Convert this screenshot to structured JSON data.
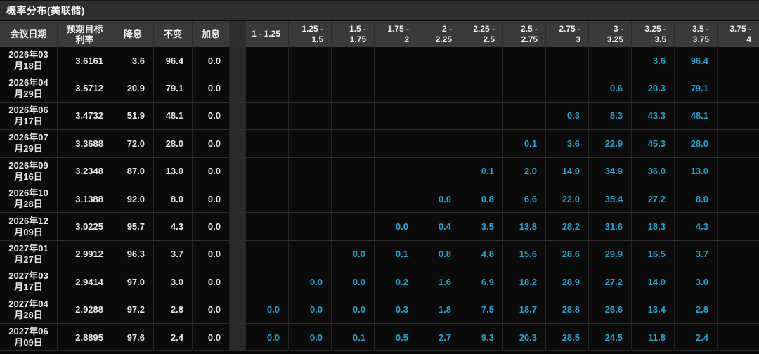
{
  "title": "概率分布(美联储)",
  "colors": {
    "accent_cyan": "#27a2d2",
    "header_bg": "#3a3a3a",
    "titlebar_bg": "#2f2f2f",
    "cell_bg": "#0b0b0b",
    "separator_col_bg": "#2b2b2b"
  },
  "table": {
    "fixed_headers": [
      {
        "name": "meeting-date",
        "lines": [
          "会议日期"
        ]
      },
      {
        "name": "expected-target-rate",
        "lines": [
          "预期目标",
          "利率"
        ]
      },
      {
        "name": "rate-cut",
        "lines": [
          "降息"
        ]
      },
      {
        "name": "unchanged",
        "lines": [
          "不变"
        ]
      },
      {
        "name": "rate-hike",
        "lines": [
          "加息"
        ]
      }
    ],
    "range_headers": [
      {
        "lines": [
          "1 - 1.25"
        ]
      },
      {
        "lines": [
          "1.25 -",
          "1.5"
        ]
      },
      {
        "lines": [
          "1.5 -",
          "1.75"
        ]
      },
      {
        "lines": [
          "1.75 -",
          "2"
        ]
      },
      {
        "lines": [
          "2 -",
          "2.25"
        ]
      },
      {
        "lines": [
          "2.25 -",
          "2.5"
        ]
      },
      {
        "lines": [
          "2.5 -",
          "2.75"
        ]
      },
      {
        "lines": [
          "2.75 -",
          "3"
        ]
      },
      {
        "lines": [
          "3 -",
          "3.25"
        ]
      },
      {
        "lines": [
          "3.25 -",
          "3.5"
        ]
      },
      {
        "lines": [
          "3.5 -",
          "3.75"
        ]
      },
      {
        "lines": [
          "3.75 -",
          "4"
        ]
      }
    ],
    "rows": [
      {
        "date_lines": [
          "2026年03",
          "月18日"
        ],
        "target": "3.6161",
        "cut": "3.6",
        "hold": "96.4",
        "hike": "0.0",
        "probs": [
          "",
          "",
          "",
          "",
          "",
          "",
          "",
          "",
          "",
          "3.6",
          "96.4",
          ""
        ]
      },
      {
        "date_lines": [
          "2026年04",
          "月29日"
        ],
        "target": "3.5712",
        "cut": "20.9",
        "hold": "79.1",
        "hike": "0.0",
        "probs": [
          "",
          "",
          "",
          "",
          "",
          "",
          "",
          "",
          "0.6",
          "20.3",
          "79.1",
          ""
        ]
      },
      {
        "date_lines": [
          "2026年06",
          "月17日"
        ],
        "target": "3.4732",
        "cut": "51.9",
        "hold": "48.1",
        "hike": "0.0",
        "probs": [
          "",
          "",
          "",
          "",
          "",
          "",
          "",
          "0.3",
          "8.3",
          "43.3",
          "48.1",
          ""
        ]
      },
      {
        "date_lines": [
          "2026年07",
          "月29日"
        ],
        "target": "3.3688",
        "cut": "72.0",
        "hold": "28.0",
        "hike": "0.0",
        "probs": [
          "",
          "",
          "",
          "",
          "",
          "",
          "0.1",
          "3.6",
          "22.9",
          "45.3",
          "28.0",
          ""
        ]
      },
      {
        "date_lines": [
          "2026年09",
          "月16日"
        ],
        "target": "3.2348",
        "cut": "87.0",
        "hold": "13.0",
        "hike": "0.0",
        "probs": [
          "",
          "",
          "",
          "",
          "",
          "0.1",
          "2.0",
          "14.0",
          "34.9",
          "36.0",
          "13.0",
          ""
        ]
      },
      {
        "date_lines": [
          "2026年10",
          "月28日"
        ],
        "target": "3.1388",
        "cut": "92.0",
        "hold": "8.0",
        "hike": "0.0",
        "probs": [
          "",
          "",
          "",
          "",
          "0.0",
          "0.8",
          "6.6",
          "22.0",
          "35.4",
          "27.2",
          "8.0",
          ""
        ]
      },
      {
        "date_lines": [
          "2026年12",
          "月09日"
        ],
        "target": "3.0225",
        "cut": "95.7",
        "hold": "4.3",
        "hike": "0.0",
        "probs": [
          "",
          "",
          "",
          "0.0",
          "0.4",
          "3.5",
          "13.8",
          "28.2",
          "31.6",
          "18.3",
          "4.3",
          ""
        ]
      },
      {
        "date_lines": [
          "2027年01",
          "月27日"
        ],
        "target": "2.9912",
        "cut": "96.3",
        "hold": "3.7",
        "hike": "0.0",
        "probs": [
          "",
          "",
          "0.0",
          "0.1",
          "0.8",
          "4.8",
          "15.6",
          "28.6",
          "29.9",
          "16.5",
          "3.7",
          ""
        ]
      },
      {
        "date_lines": [
          "2027年03",
          "月17日"
        ],
        "target": "2.9414",
        "cut": "97.0",
        "hold": "3.0",
        "hike": "0.0",
        "probs": [
          "",
          "0.0",
          "0.0",
          "0.2",
          "1.6",
          "6.9",
          "18.2",
          "28.9",
          "27.2",
          "14.0",
          "3.0",
          ""
        ]
      },
      {
        "date_lines": [
          "2027年04",
          "月28日"
        ],
        "target": "2.9288",
        "cut": "97.2",
        "hold": "2.8",
        "hike": "0.0",
        "probs": [
          "0.0",
          "0.0",
          "0.0",
          "0.3",
          "1.8",
          "7.5",
          "18.7",
          "28.8",
          "26.6",
          "13.4",
          "2.8",
          ""
        ]
      },
      {
        "date_lines": [
          "2027年06",
          "月09日"
        ],
        "target": "2.8895",
        "cut": "97.6",
        "hold": "2.4",
        "hike": "0.0",
        "probs": [
          "0.0",
          "0.0",
          "0.1",
          "0.5",
          "2.7",
          "9.3",
          "20.3",
          "28.5",
          "24.5",
          "11.8",
          "2.4",
          ""
        ]
      }
    ]
  }
}
